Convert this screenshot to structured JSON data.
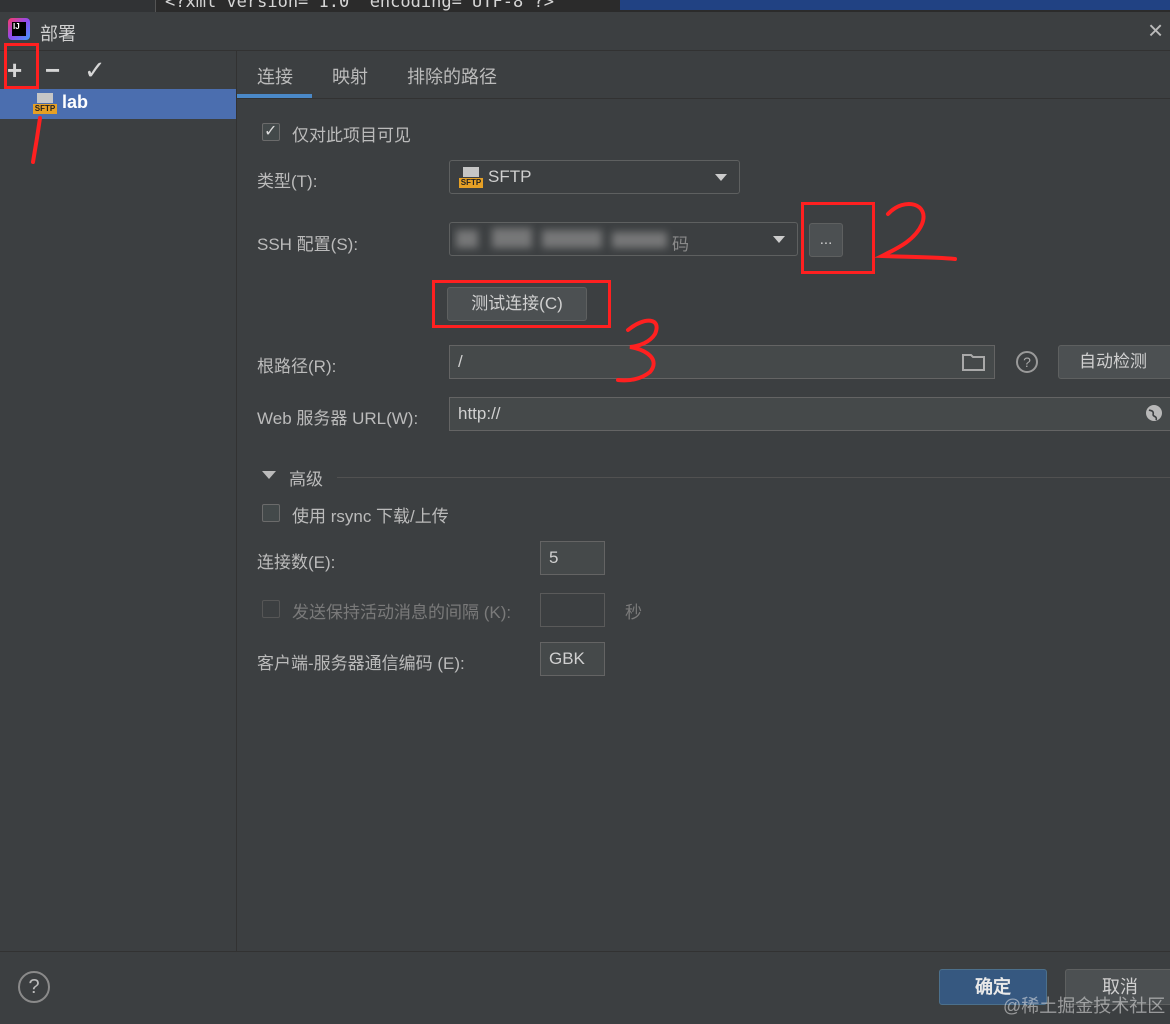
{
  "editor": {
    "code_line": "<?xml version=\"1.0\" encoding=\"UTF-8\"?>"
  },
  "window": {
    "title": "部署",
    "app_icon_text": "IJ"
  },
  "toolbar": {
    "add": "+",
    "remove": "−",
    "apply": "✓"
  },
  "tree": {
    "items": [
      {
        "label": "lab",
        "icon": "sftp-server-icon",
        "selected": true
      }
    ]
  },
  "sftp_badge": "SFTP",
  "tabs": [
    {
      "label": "连接",
      "active": true
    },
    {
      "label": "映射",
      "active": false
    },
    {
      "label": "排除的路径",
      "active": false
    }
  ],
  "connection": {
    "visible_only_label": "仅对此项目可见",
    "visible_only_checked": true,
    "type_label": "类型(T):",
    "type_value": "SFTP",
    "ssh_label": "SSH 配置(S):",
    "ssh_value_tail": "码",
    "ssh_more_button": "...",
    "test_button": "测试连接(C)",
    "root_label": "根路径(R):",
    "root_value": "/",
    "autodetect_button": "自动检测",
    "web_label": "Web 服务器 URL(W):",
    "web_value": "http://"
  },
  "advanced": {
    "section_title": "高级",
    "rsync_label": "使用 rsync 下载/上传",
    "rsync_checked": false,
    "connections_label": "连接数(E):",
    "connections_value": "5",
    "keepalive_label": "发送保持活动消息的间隔 (K):",
    "keepalive_value": "",
    "keepalive_unit": "秒",
    "encoding_label": "客户端-服务器通信编码 (E):",
    "encoding_value": "GBK"
  },
  "footer": {
    "help": "?",
    "ok": "确定",
    "cancel": "取消"
  },
  "watermark": "@稀土掘金技术社区",
  "colors": {
    "accent": "#4b6eaf",
    "annotation_red": "#ff2020",
    "tab_underline": "#4a88c7"
  }
}
